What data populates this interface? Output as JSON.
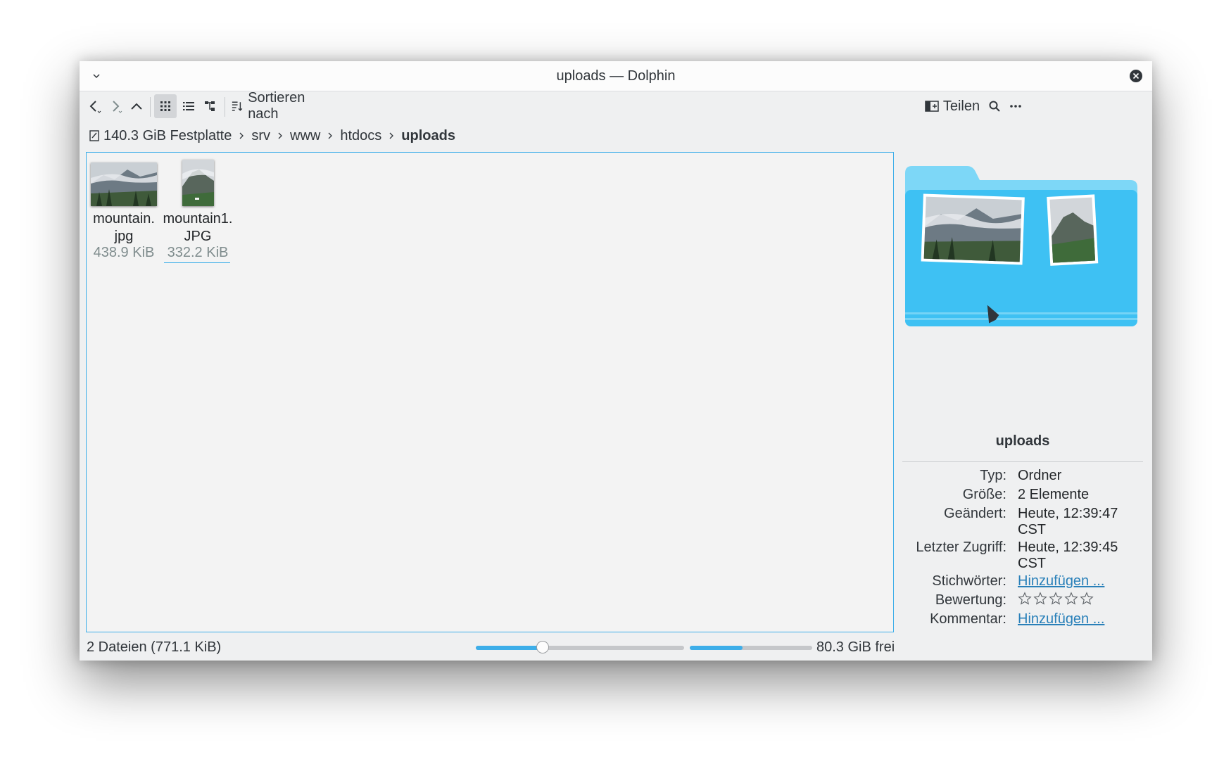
{
  "window": {
    "title": "uploads — Dolphin"
  },
  "toolbar": {
    "sort_label": "Sortieren nach",
    "share_label": "Teilen",
    "icons": [
      "back-icon",
      "forward-icon",
      "up-icon",
      "icons-view-icon",
      "details-view-icon",
      "split-view-icon",
      "sort-icon",
      "share-icon",
      "search-icon",
      "more-icon"
    ]
  },
  "breadcrumb": {
    "items": [
      "140.3 GiB Festplatte",
      "srv",
      "www",
      "htdocs",
      "uploads"
    ]
  },
  "files": [
    {
      "name": "mountain.\njpg",
      "size": "438.9 KiB"
    },
    {
      "name": "mountain1.\nJPG",
      "size": "332.2 KiB"
    }
  ],
  "info": {
    "title": "uploads",
    "rows": [
      {
        "label": "Typ:",
        "value": "Ordner"
      },
      {
        "label": "Größe:",
        "value": "2 Elemente"
      },
      {
        "label": "Geändert:",
        "value": "Heute, 12:39:47 CST"
      },
      {
        "label": "Letzter Zugriff:",
        "value": "Heute, 12:39:45 CST"
      },
      {
        "label": "Stichwörter:",
        "value": "Hinzufügen ..."
      },
      {
        "label": "Bewertung:",
        "value": ""
      },
      {
        "label": "Kommentar:",
        "value": "Hinzufügen ..."
      }
    ],
    "rating": 0,
    "rating_max": 5
  },
  "status": {
    "text": "2 Dateien (771.1 KiB)",
    "zoom_fraction": 0.32,
    "used_fraction": 0.43,
    "free_text": "80.3 GiB frei"
  },
  "colors": {
    "accent": "#3daee9",
    "link": "#2980b9",
    "folder": "#3ec1f3"
  }
}
